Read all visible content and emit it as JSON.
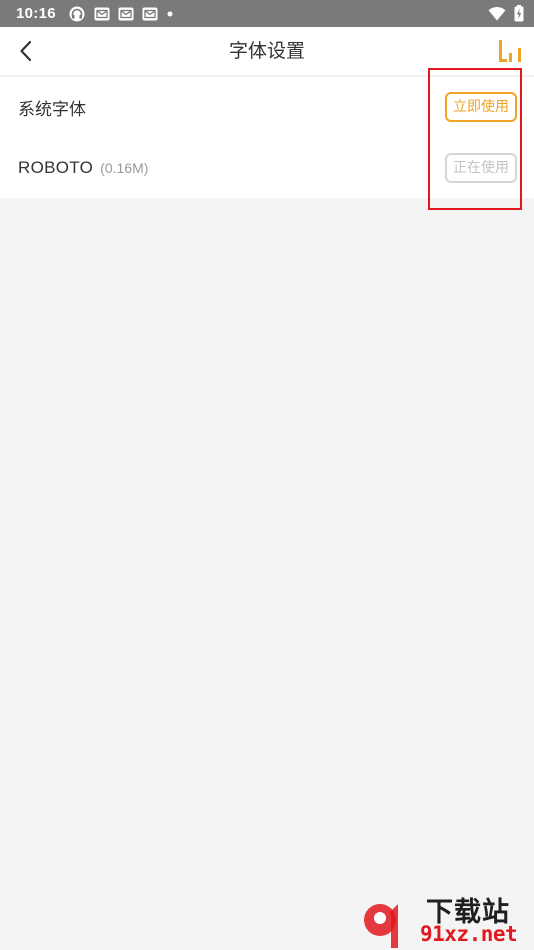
{
  "status_bar": {
    "time": "10:16",
    "left_icons": [
      "headset-icon",
      "mail-icon",
      "mail-icon",
      "mail-icon",
      "dot-icon"
    ],
    "right_icons": [
      "wifi-icon",
      "battery-charging-icon"
    ]
  },
  "app_bar": {
    "title": "字体设置",
    "back_icon": "chevron-left-icon",
    "action_icon": "bar-chart-icon",
    "accent": "#f0a424"
  },
  "fonts": [
    {
      "name": "系统字体",
      "size": "",
      "action": "立即使用",
      "state": "available"
    },
    {
      "name": "ROBOTO",
      "size": "(0.16M)",
      "action": "正在使用",
      "state": "in-use"
    }
  ],
  "colors": {
    "accent": "#f0a424",
    "disabled": "#c4c4c4",
    "highlight": "#e1191e",
    "background": "#f4f4f4"
  },
  "watermark": {
    "title": "下载站",
    "url": "91xz.net"
  }
}
